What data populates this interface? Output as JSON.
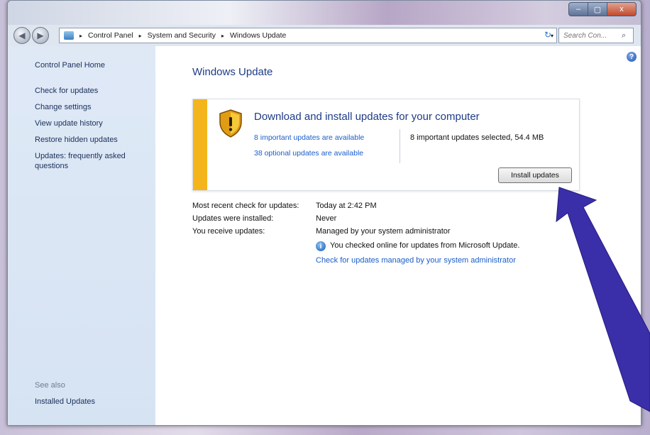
{
  "window": {
    "controls": {
      "minimize": "–",
      "maximize": "▢",
      "close": "x"
    }
  },
  "navbar": {
    "back_icon": "◀",
    "forward_icon": "▶",
    "breadcrumbs": [
      "Control Panel",
      "System and Security",
      "Windows Update"
    ],
    "separator": "▸",
    "dropdown": "▾",
    "refresh": "↻",
    "search_placeholder": "Search Con...",
    "search_icon": "⌕"
  },
  "sidebar": {
    "home": "Control Panel Home",
    "items": [
      "Check for updates",
      "Change settings",
      "View update history",
      "Restore hidden updates",
      "Updates: frequently asked questions"
    ],
    "see_also_label": "See also",
    "see_also_items": [
      "Installed Updates"
    ]
  },
  "main": {
    "help": "?",
    "title": "Windows Update",
    "panel": {
      "heading": "Download and install updates for your computer",
      "important_link": "8 important updates are available",
      "optional_link": "38 optional updates are available",
      "selected_summary": "8 important updates selected, 54.4 MB",
      "install_button": "Install updates"
    },
    "info": {
      "rows": [
        {
          "label": "Most recent check for updates:",
          "value": "Today at 2:42 PM"
        },
        {
          "label": "Updates were installed:",
          "value": "Never"
        },
        {
          "label": "You receive updates:",
          "value": "Managed by your system administrator"
        }
      ],
      "note": "You checked online for updates from Microsoft Update.",
      "note_icon": "i",
      "admin_link": "Check for updates managed by your system administrator"
    }
  },
  "colors": {
    "accent_blue": "#1d3b87",
    "link_blue": "#1a5dc9",
    "warning_stripe": "#f3b51b",
    "arrow": "#3a2fa8"
  }
}
